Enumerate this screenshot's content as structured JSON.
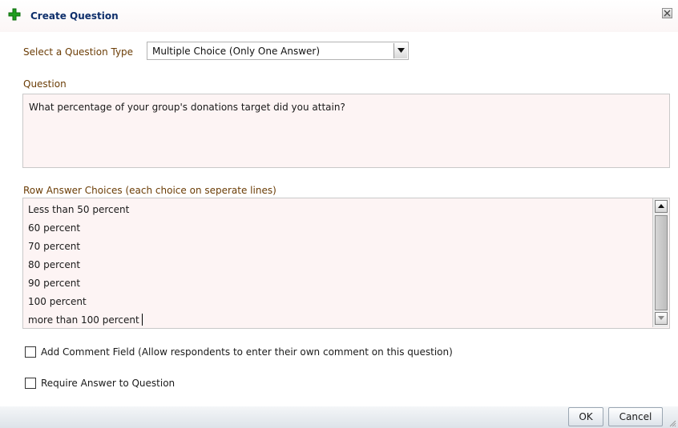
{
  "dialog": {
    "title": "Create Question"
  },
  "question_type": {
    "label": "Select a Question Type",
    "selected": "Multiple Choice (Only One Answer)"
  },
  "question": {
    "label": "Question",
    "value": "What percentage of your group's donations target did you attain?"
  },
  "answers": {
    "label": "Row Answer Choices (each choice on seperate lines)",
    "lines": [
      "Less than 50 percent",
      "60 percent",
      "70 percent",
      "80 percent",
      "90 percent",
      "100 percent",
      "more than 100 percent"
    ]
  },
  "options": {
    "comment_field": {
      "label": "Add Comment Field (Allow respondents to enter their own comment on this question)",
      "checked": false
    },
    "require_answer": {
      "label": "Require Answer to Question",
      "checked": false
    }
  },
  "buttons": {
    "ok": "OK",
    "cancel": "Cancel"
  },
  "colors": {
    "title": "#0e2f6b",
    "label": "#6b3d06",
    "field_bg": "#fdf4f4",
    "plus_icon": "#1f9e1f"
  }
}
